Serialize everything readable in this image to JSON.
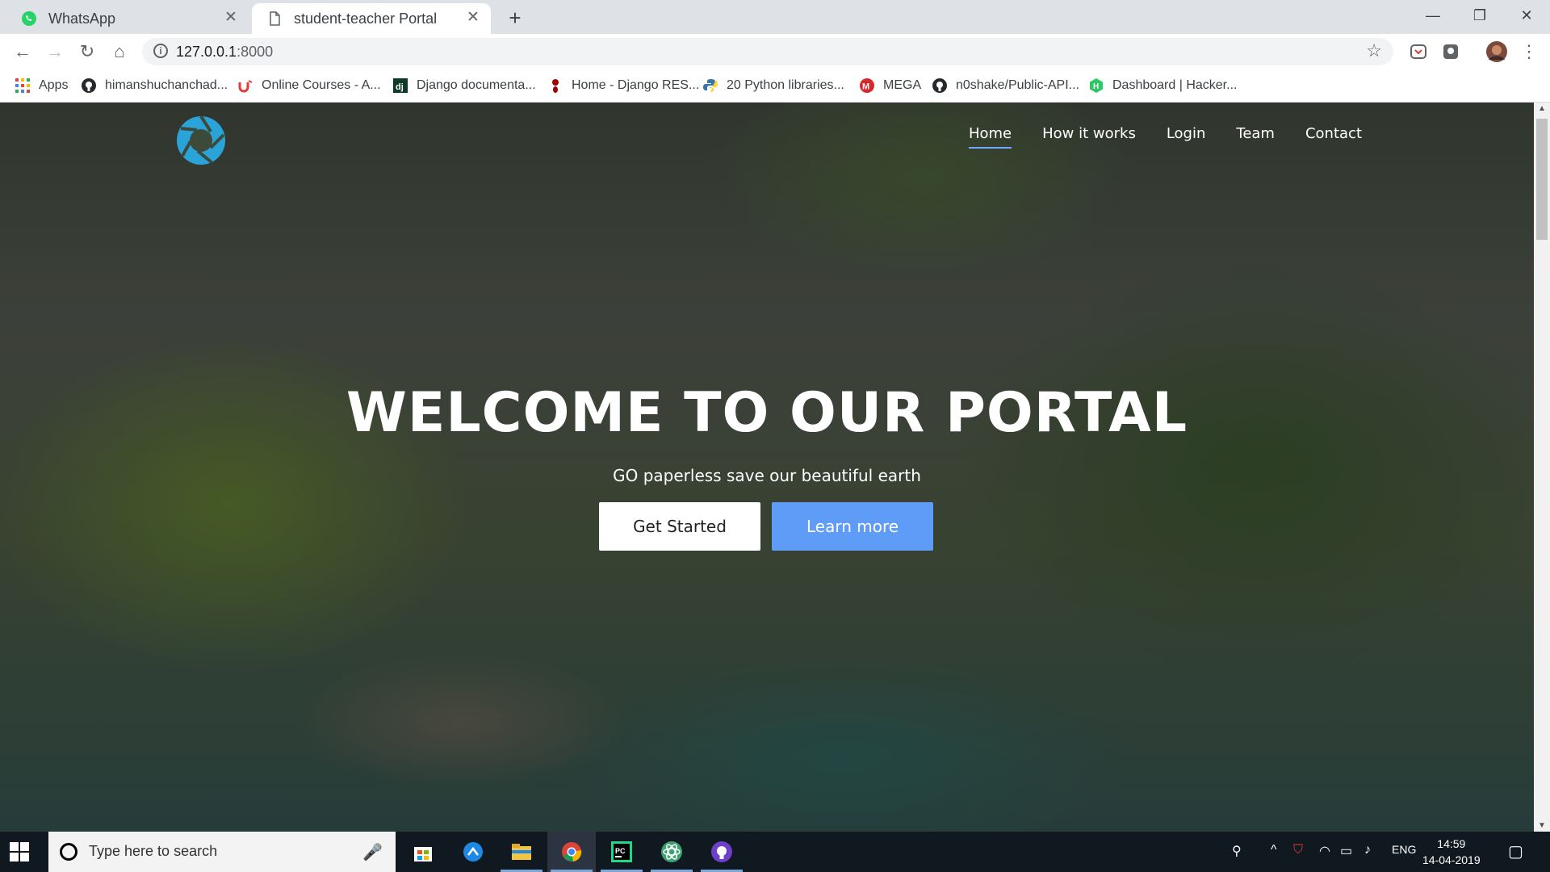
{
  "browser": {
    "tabs": [
      {
        "title": "WhatsApp",
        "icon": "whatsapp-icon"
      },
      {
        "title": "student-teacher Portal",
        "icon": "page-icon",
        "active": true
      }
    ],
    "url_host": "127.0.0.1",
    "url_port": ":8000",
    "bookmarks": [
      {
        "label": "Apps",
        "icon": "apps-grid-icon"
      },
      {
        "label": "himanshuchanchad...",
        "icon": "github-icon"
      },
      {
        "label": "Online Courses - A...",
        "icon": "udemy-icon"
      },
      {
        "label": "Django documenta...",
        "icon": "django-icon"
      },
      {
        "label": "Home - Django RES...",
        "icon": "drf-icon"
      },
      {
        "label": "20 Python libraries...",
        "icon": "python-icon"
      },
      {
        "label": "MEGA",
        "icon": "mega-icon"
      },
      {
        "label": "n0shake/Public-API...",
        "icon": "github-icon"
      },
      {
        "label": "Dashboard | Hacker...",
        "icon": "hackerrank-icon"
      }
    ]
  },
  "site": {
    "nav": [
      "Home",
      "How it works",
      "Login",
      "Team",
      "Contact"
    ],
    "active_nav": "Home",
    "hero_title": "WELCOME TO OUR PORTAL",
    "hero_subtitle": "GO paperless save our beautiful earth",
    "buttons": {
      "primary": "Get Started",
      "secondary": "Learn more"
    },
    "colors": {
      "accent": "#5f9cf8",
      "logo": "#2aa3d8"
    }
  },
  "taskbar": {
    "search_placeholder": "Type here to search",
    "apps": [
      "store-icon",
      "network-app-icon",
      "file-explorer-icon",
      "chrome-icon",
      "pycharm-icon",
      "atom-icon",
      "github-desktop-icon"
    ],
    "language": "ENG",
    "time": "14:59",
    "date": "14-04-2019"
  }
}
